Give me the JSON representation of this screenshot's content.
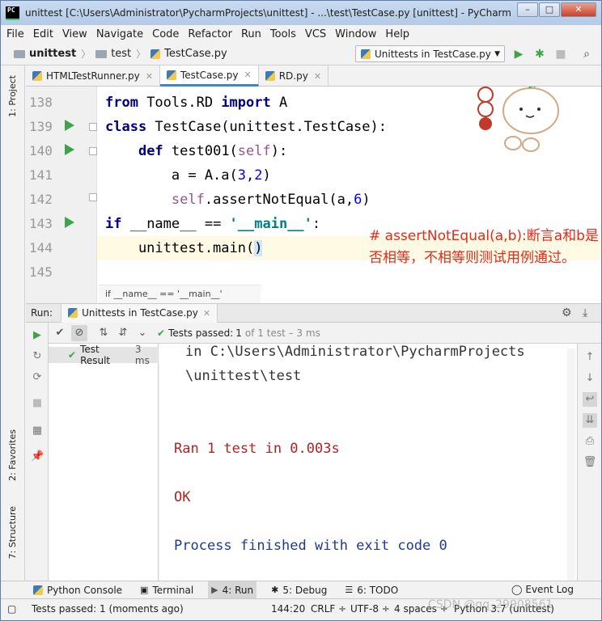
{
  "window": {
    "title": "unittest [C:\\Users\\Administrator\\PycharmProjects\\unittest] - ...\\test\\TestCase.py [unittest] - PyCharm (A...",
    "app_icon": "PC"
  },
  "menu": [
    "File",
    "Edit",
    "View",
    "Navigate",
    "Code",
    "Refactor",
    "Run",
    "Tools",
    "VCS",
    "Window",
    "Help"
  ],
  "nav": {
    "crumbs": [
      "unittest",
      "test",
      "TestCase.py"
    ],
    "run_config": "Unittests in TestCase.py"
  },
  "left_strip": {
    "project": "1: Project",
    "favorites": "2: Favorites",
    "structure": "7: Structure"
  },
  "tabs": [
    "HTMLTestRunner.py",
    "TestCase.py",
    "RD.py"
  ],
  "editor": {
    "line_numbers": [
      "138",
      "139",
      "140",
      "141",
      "142",
      "143",
      "144",
      "145"
    ],
    "breadcrumb": "if __name__ == '__main__'",
    "annotation": "# assertNotEqual(a,b):断言a和b是否相等，不相等则测试用例通过。"
  },
  "run_panel": {
    "label": "Run:",
    "tab": "Unittests in TestCase.py",
    "tests_passed": "Tests passed:",
    "passed_count": "1",
    "passed_detail": "of 1 test – 3 ms",
    "tree_item": "Test Result",
    "tree_duration": "3 ms",
    "console_lines": [
      "in C:\\Users\\Administrator\\PycharmProjects",
      "\\unittest\\test",
      "Ran 1 test in 0.003s",
      "OK",
      "Process finished with exit code 0"
    ]
  },
  "tool_tabs": [
    "Python Console",
    "Terminal",
    "4: Run",
    "5: Debug",
    "6: TODO"
  ],
  "event_log": "Event Log",
  "status": {
    "message": "Tests passed: 1 (moments ago)",
    "position": "144:20",
    "line_sep": "CRLF ÷",
    "encoding": "UTF-8 ÷",
    "indent": "4 spaces ÷",
    "interpreter": "Python 3.7 (unittest)"
  },
  "watermark": "CSDN @qq_29908561",
  "colors": {
    "accent": "#4083c9",
    "run_green": "#3fa34d",
    "annotation_red": "#e42a1d",
    "console_red": "#b22222",
    "console_blue": "#1f3a93"
  }
}
